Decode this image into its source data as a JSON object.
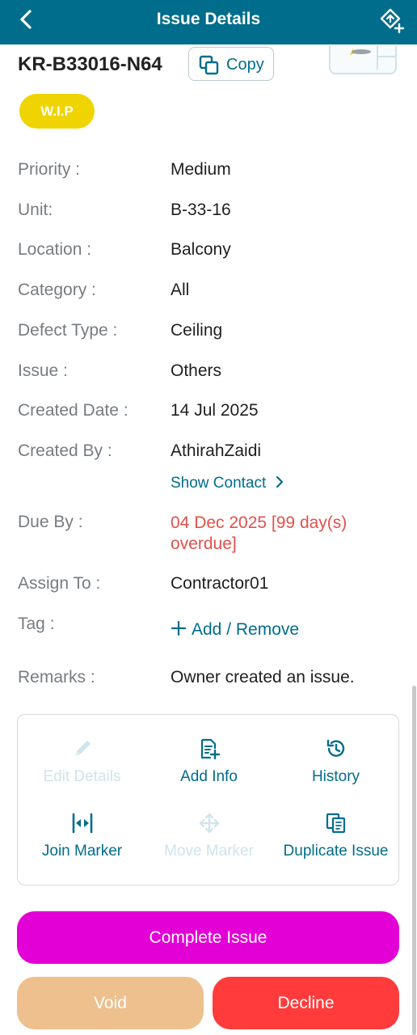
{
  "header": {
    "title": "Issue Details",
    "back_icon": "chevron-left-icon",
    "action_icon": "marker-add-icon"
  },
  "issue": {
    "id": "KR-B33016-N64",
    "copy_label": "Copy",
    "status": "W.I.P"
  },
  "details": {
    "priority": {
      "label": "Priority :",
      "value": "Medium"
    },
    "unit": {
      "label": "Unit:",
      "value": "B-33-16"
    },
    "location": {
      "label": "Location :",
      "value": "Balcony"
    },
    "category": {
      "label": "Category :",
      "value": "All"
    },
    "defect_type": {
      "label": "Defect Type :",
      "value": "Ceiling"
    },
    "issue": {
      "label": "Issue :",
      "value": "Others"
    },
    "created_date": {
      "label": "Created Date :",
      "value": "14 Jul 2025"
    },
    "created_by": {
      "label": "Created By :",
      "value": "AthirahZaidi",
      "show_contact": "Show Contact"
    },
    "due_by": {
      "label": "Due By :",
      "value": "04 Dec 2025 [99 day(s) overdue]"
    },
    "assign_to": {
      "label": "Assign To :",
      "value": "Contractor01"
    },
    "tag": {
      "label": "Tag :",
      "action": "Add / Remove"
    },
    "remarks": {
      "label": "Remarks :",
      "value": "Owner created an issue."
    }
  },
  "actions": {
    "edit_details": "Edit Details",
    "add_info": "Add Info",
    "history": "History",
    "join_marker": "Join Marker",
    "move_marker": "Move Marker",
    "duplicate_issue": "Duplicate Issue"
  },
  "buttons": {
    "complete": "Complete Issue",
    "void": "Void",
    "decline": "Decline"
  },
  "colors": {
    "primary": "#006d8c",
    "status_wip": "#f0d400",
    "overdue": "#e2504b",
    "complete": "#e300d6",
    "void": "#edc08e",
    "decline": "#ff3b3b"
  }
}
